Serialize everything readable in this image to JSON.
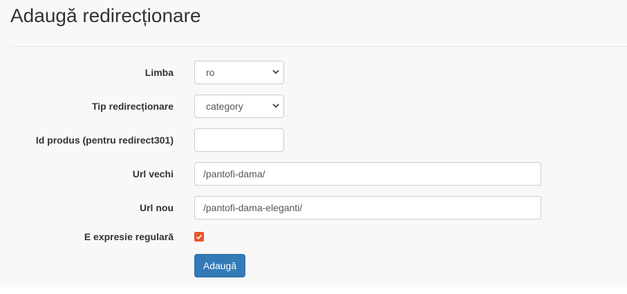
{
  "page": {
    "title": "Adaugă redirecționare"
  },
  "form": {
    "language": {
      "label": "Limba",
      "value": "ro"
    },
    "redirect_type": {
      "label": "Tip redirecționare",
      "value": "category"
    },
    "product_id": {
      "label": "Id produs (pentru redirect301)",
      "value": ""
    },
    "old_url": {
      "label": "Url vechi",
      "value": "/pantofi-dama/"
    },
    "new_url": {
      "label": "Url nou",
      "value": "/pantofi-dama-eleganti/"
    },
    "is_regex": {
      "label": "E expresie regulară",
      "checked": true
    },
    "submit_label": "Adaugă"
  },
  "colors": {
    "accent_checkbox": "#e8552b",
    "primary_button": "#337ab7",
    "panel_background": "#f8f8f8"
  },
  "icons": {
    "select_arrow": "chevron-down-icon",
    "checkbox_mark": "check-icon"
  }
}
